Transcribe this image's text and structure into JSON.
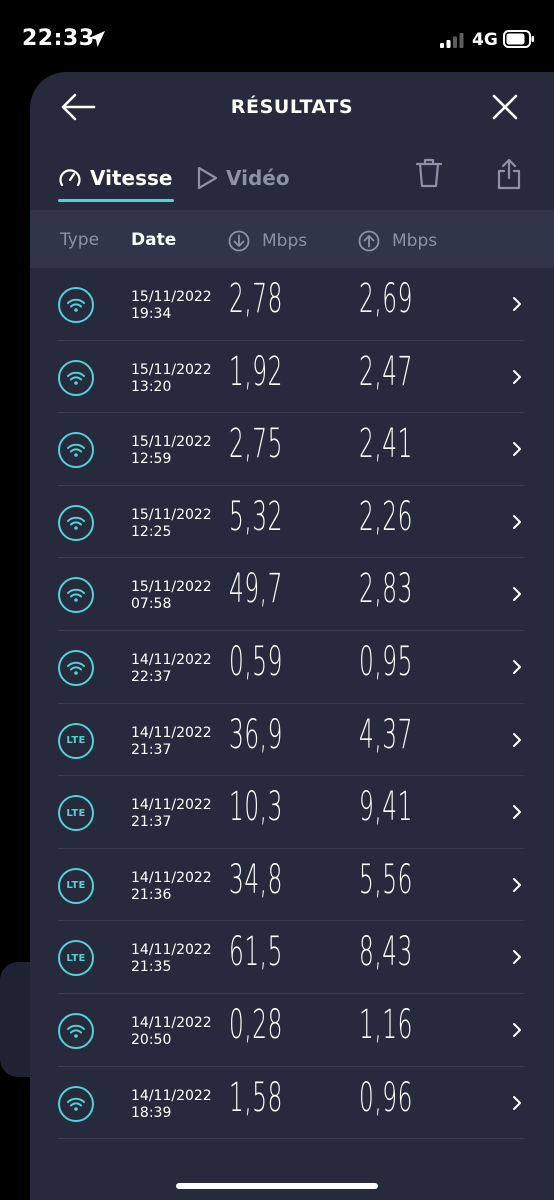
{
  "status_bar": {
    "time": "22:33",
    "network": "4G"
  },
  "header": {
    "title": "RÉSULTATS"
  },
  "tabs": [
    {
      "label": "Vitesse",
      "icon": "speedometer-icon",
      "active": true
    },
    {
      "label": "Vidéo",
      "icon": "play-icon",
      "active": false
    }
  ],
  "table": {
    "headers": {
      "type": "Type",
      "date": "Date",
      "download": "Mbps",
      "upload": "Mbps"
    },
    "rows": [
      {
        "type": "wifi",
        "date": "15/11/2022",
        "time": "19:34",
        "down": "2,78",
        "up": "2,69"
      },
      {
        "type": "wifi",
        "date": "15/11/2022",
        "time": "13:20",
        "down": "1,92",
        "up": "2,47"
      },
      {
        "type": "wifi",
        "date": "15/11/2022",
        "time": "12:59",
        "down": "2,75",
        "up": "2,41"
      },
      {
        "type": "wifi",
        "date": "15/11/2022",
        "time": "12:25",
        "down": "5,32",
        "up": "2,26"
      },
      {
        "type": "wifi",
        "date": "15/11/2022",
        "time": "07:58",
        "down": "49,7",
        "up": "2,83"
      },
      {
        "type": "wifi",
        "date": "14/11/2022",
        "time": "22:37",
        "down": "0,59",
        "up": "0,95"
      },
      {
        "type": "lte",
        "label": "LTE",
        "date": "14/11/2022",
        "time": "21:37",
        "down": "36,9",
        "up": "4,37"
      },
      {
        "type": "lte",
        "label": "LTE",
        "date": "14/11/2022",
        "time": "21:37",
        "down": "10,3",
        "up": "9,41"
      },
      {
        "type": "lte",
        "label": "LTE",
        "date": "14/11/2022",
        "time": "21:36",
        "down": "34,8",
        "up": "5,56"
      },
      {
        "type": "lte",
        "label": "LTE",
        "date": "14/11/2022",
        "time": "21:35",
        "down": "61,5",
        "up": "8,43"
      },
      {
        "type": "wifi",
        "date": "14/11/2022",
        "time": "20:50",
        "down": "0,28",
        "up": "1,16"
      },
      {
        "type": "wifi",
        "date": "14/11/2022",
        "time": "18:39",
        "down": "1,58",
        "up": "0,96"
      }
    ]
  },
  "colors": {
    "accent": "#4fd3d3",
    "sheet": "#262a3c",
    "header_row": "#30354a",
    "muted": "#8b91a8"
  }
}
